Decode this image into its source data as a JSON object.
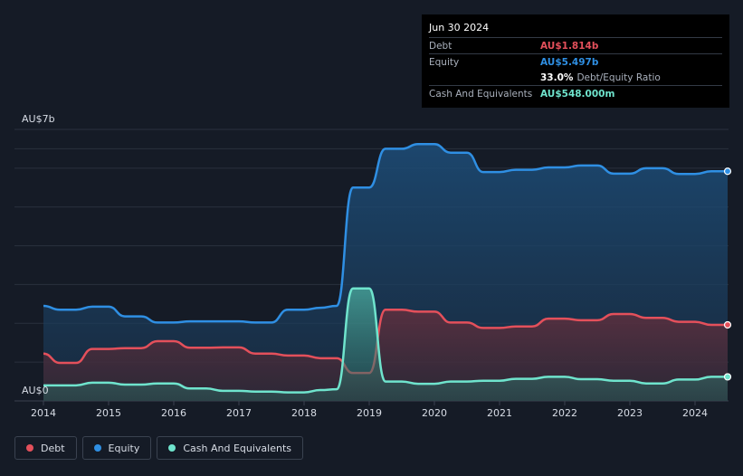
{
  "tooltip": {
    "date": "Jun 30 2024",
    "debt_label": "Debt",
    "debt_value": "AU$1.814b",
    "equity_label": "Equity",
    "equity_value": "AU$5.497b",
    "ratio_value": "33.0%",
    "ratio_label": "Debt/Equity Ratio",
    "cash_label": "Cash And Equivalents",
    "cash_value": "AU$548.000m"
  },
  "legend": {
    "debt": "Debt",
    "equity": "Equity",
    "cash": "Cash And Equivalents"
  },
  "colors": {
    "debt": "#e4505b",
    "equity": "#2f8fe3",
    "cash": "#6fe4cd",
    "background": "#151b26"
  },
  "chart_data": {
    "type": "area",
    "y_top_label": "AU$7b",
    "y_bottom_label": "AU$0",
    "ylim": [
      0,
      7
    ],
    "xlim": [
      2014.0,
      2024.5
    ],
    "x_ticks": [
      "2014",
      "2015",
      "2016",
      "2017",
      "2018",
      "2019",
      "2020",
      "2021",
      "2022",
      "2023",
      "2024"
    ],
    "legend_position": "bottom-left",
    "series": [
      {
        "name": "Equity",
        "points": [
          [
            2014.0,
            2.45
          ],
          [
            2014.25,
            2.35
          ],
          [
            2014.5,
            2.35
          ],
          [
            2014.75,
            2.43
          ],
          [
            2015.0,
            2.43
          ],
          [
            2015.25,
            2.18
          ],
          [
            2015.5,
            2.18
          ],
          [
            2015.75,
            2.02
          ],
          [
            2016.0,
            2.02
          ],
          [
            2016.25,
            2.05
          ],
          [
            2016.5,
            2.05
          ],
          [
            2016.75,
            2.05
          ],
          [
            2017.0,
            2.05
          ],
          [
            2017.25,
            2.02
          ],
          [
            2017.5,
            2.02
          ],
          [
            2017.75,
            2.35
          ],
          [
            2018.0,
            2.35
          ],
          [
            2018.25,
            2.4
          ],
          [
            2018.5,
            2.45
          ],
          [
            2018.75,
            5.5
          ],
          [
            2019.0,
            5.5
          ],
          [
            2019.25,
            6.5
          ],
          [
            2019.5,
            6.5
          ],
          [
            2019.75,
            6.62
          ],
          [
            2020.0,
            6.62
          ],
          [
            2020.25,
            6.4
          ],
          [
            2020.5,
            6.4
          ],
          [
            2020.75,
            5.9
          ],
          [
            2021.0,
            5.9
          ],
          [
            2021.25,
            5.96
          ],
          [
            2021.5,
            5.96
          ],
          [
            2021.75,
            6.02
          ],
          [
            2022.0,
            6.02
          ],
          [
            2022.25,
            6.07
          ],
          [
            2022.5,
            6.07
          ],
          [
            2022.75,
            5.86
          ],
          [
            2023.0,
            5.86
          ],
          [
            2023.25,
            6.0
          ],
          [
            2023.5,
            6.0
          ],
          [
            2023.75,
            5.85
          ],
          [
            2024.0,
            5.85
          ],
          [
            2024.25,
            5.92
          ],
          [
            2024.5,
            5.92
          ]
        ]
      },
      {
        "name": "Debt",
        "points": [
          [
            2014.0,
            1.22
          ],
          [
            2014.25,
            0.98
          ],
          [
            2014.5,
            0.98
          ],
          [
            2014.75,
            1.34
          ],
          [
            2015.0,
            1.34
          ],
          [
            2015.25,
            1.36
          ],
          [
            2015.5,
            1.36
          ],
          [
            2015.75,
            1.54
          ],
          [
            2016.0,
            1.54
          ],
          [
            2016.25,
            1.37
          ],
          [
            2016.5,
            1.37
          ],
          [
            2016.75,
            1.38
          ],
          [
            2017.0,
            1.38
          ],
          [
            2017.25,
            1.22
          ],
          [
            2017.5,
            1.22
          ],
          [
            2017.75,
            1.17
          ],
          [
            2018.0,
            1.17
          ],
          [
            2018.25,
            1.1
          ],
          [
            2018.5,
            1.1
          ],
          [
            2018.75,
            0.72
          ],
          [
            2019.0,
            0.72
          ],
          [
            2019.25,
            2.35
          ],
          [
            2019.5,
            2.35
          ],
          [
            2019.75,
            2.3
          ],
          [
            2020.0,
            2.3
          ],
          [
            2020.25,
            2.02
          ],
          [
            2020.5,
            2.02
          ],
          [
            2020.75,
            1.88
          ],
          [
            2021.0,
            1.88
          ],
          [
            2021.25,
            1.92
          ],
          [
            2021.5,
            1.92
          ],
          [
            2021.75,
            2.12
          ],
          [
            2022.0,
            2.12
          ],
          [
            2022.25,
            2.08
          ],
          [
            2022.5,
            2.08
          ],
          [
            2022.75,
            2.24
          ],
          [
            2023.0,
            2.24
          ],
          [
            2023.25,
            2.14
          ],
          [
            2023.5,
            2.14
          ],
          [
            2023.75,
            2.04
          ],
          [
            2024.0,
            2.04
          ],
          [
            2024.25,
            1.96
          ],
          [
            2024.5,
            1.96
          ]
        ]
      },
      {
        "name": "Cash And Equivalents",
        "points": [
          [
            2014.0,
            0.4
          ],
          [
            2014.25,
            0.4
          ],
          [
            2014.5,
            0.4
          ],
          [
            2014.75,
            0.47
          ],
          [
            2015.0,
            0.47
          ],
          [
            2015.25,
            0.42
          ],
          [
            2015.5,
            0.42
          ],
          [
            2015.75,
            0.45
          ],
          [
            2016.0,
            0.45
          ],
          [
            2016.25,
            0.32
          ],
          [
            2016.5,
            0.32
          ],
          [
            2016.75,
            0.26
          ],
          [
            2017.0,
            0.26
          ],
          [
            2017.25,
            0.24
          ],
          [
            2017.5,
            0.24
          ],
          [
            2017.75,
            0.22
          ],
          [
            2018.0,
            0.22
          ],
          [
            2018.25,
            0.28
          ],
          [
            2018.5,
            0.3
          ],
          [
            2018.75,
            2.9
          ],
          [
            2019.0,
            2.9
          ],
          [
            2019.25,
            0.5
          ],
          [
            2019.5,
            0.5
          ],
          [
            2019.75,
            0.44
          ],
          [
            2020.0,
            0.44
          ],
          [
            2020.25,
            0.5
          ],
          [
            2020.5,
            0.5
          ],
          [
            2020.75,
            0.52
          ],
          [
            2021.0,
            0.52
          ],
          [
            2021.25,
            0.57
          ],
          [
            2021.5,
            0.57
          ],
          [
            2021.75,
            0.62
          ],
          [
            2022.0,
            0.62
          ],
          [
            2022.25,
            0.56
          ],
          [
            2022.5,
            0.56
          ],
          [
            2022.75,
            0.52
          ],
          [
            2023.0,
            0.52
          ],
          [
            2023.25,
            0.45
          ],
          [
            2023.5,
            0.45
          ],
          [
            2023.75,
            0.55
          ],
          [
            2024.0,
            0.55
          ],
          [
            2024.25,
            0.62
          ],
          [
            2024.5,
            0.62
          ]
        ]
      }
    ]
  }
}
